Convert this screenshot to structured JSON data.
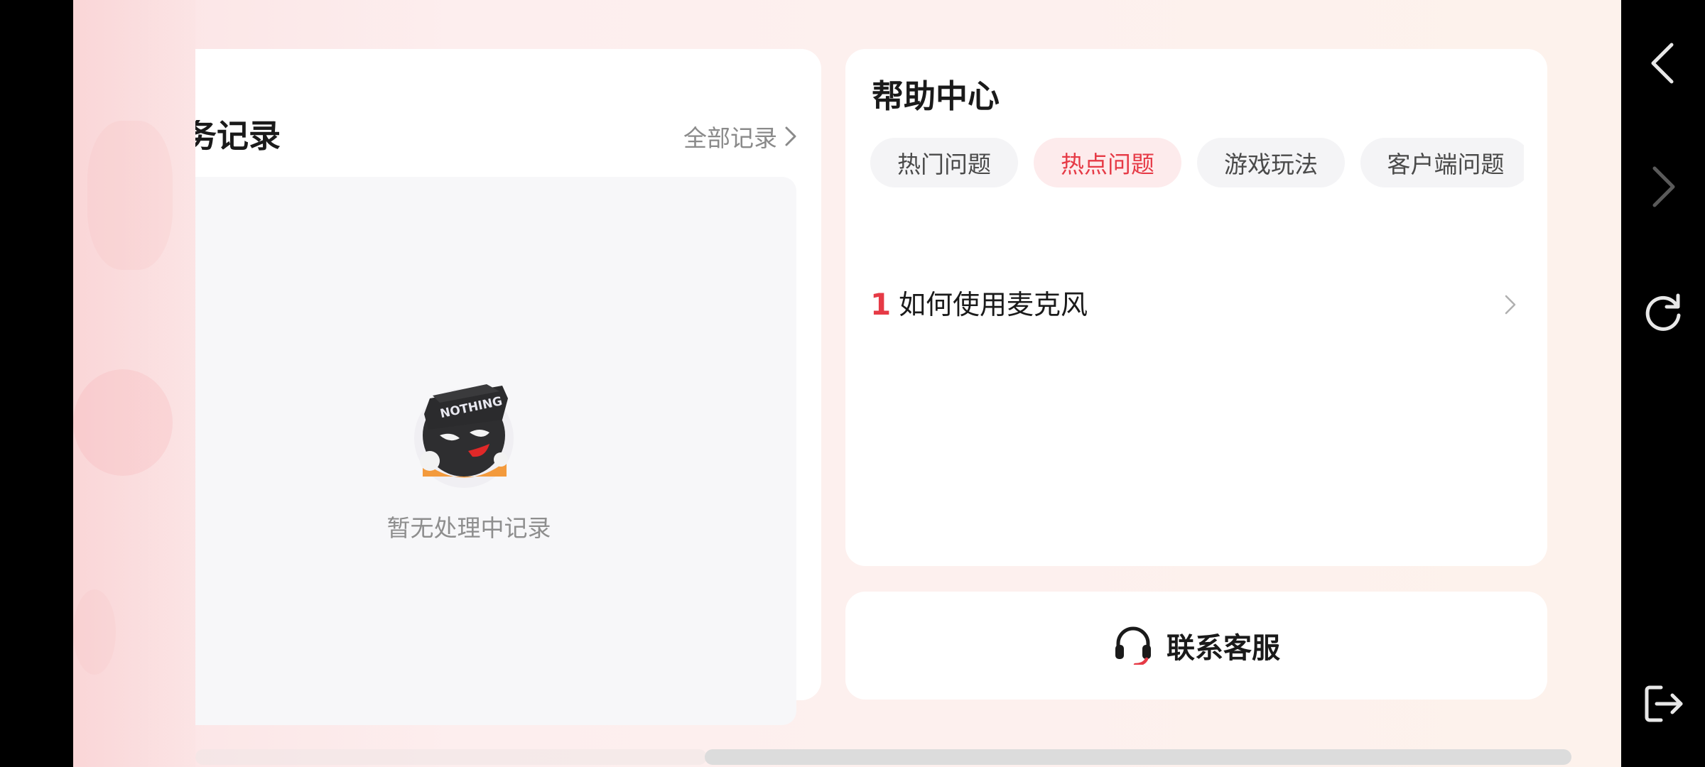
{
  "records_card": {
    "title_partial": "务记录",
    "all_records_label": "全部记录",
    "empty_text": "暂无处理中记录",
    "mascot_hat_text": "NOTHING"
  },
  "help_center": {
    "title": "帮助中心",
    "tabs": [
      {
        "label": "热门问题",
        "active": false
      },
      {
        "label": "热点问题",
        "active": true
      },
      {
        "label": "游戏玩法",
        "active": false
      },
      {
        "label": "客户端问题",
        "active": false
      }
    ],
    "faq": [
      {
        "num": "1",
        "text": "如何使用麦克风"
      }
    ]
  },
  "contact": {
    "label": "联系客服"
  },
  "icons": {
    "back": "back-arrow-icon",
    "forward": "forward-arrow-icon",
    "refresh": "refresh-icon",
    "exit": "exit-icon",
    "headset": "headset-icon",
    "chevron": "chevron-right-icon"
  },
  "colors": {
    "accent": "#e63a46",
    "tab_active_bg": "#fdebec",
    "tab_bg": "#f4f4f6"
  }
}
